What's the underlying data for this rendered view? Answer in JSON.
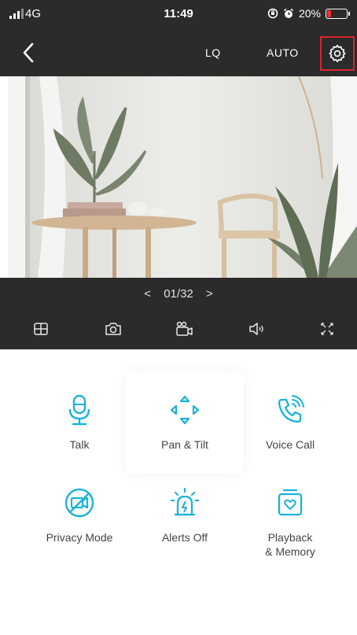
{
  "status_bar": {
    "network": "4G",
    "time": "11:49",
    "battery": "20%"
  },
  "nav": {
    "quality": "LQ",
    "mode": "AUTO"
  },
  "video": {
    "page": "01/32",
    "prev_symbol": "<",
    "next_symbol": ">"
  },
  "features": [
    {
      "label": "Talk",
      "icon": "microphone-icon"
    },
    {
      "label": "Pan & Tilt",
      "icon": "pan-tilt-icon"
    },
    {
      "label": "Voice Call",
      "icon": "phone-call-icon"
    },
    {
      "label": "Privacy Mode",
      "icon": "privacy-camera-off-icon"
    },
    {
      "label": "Alerts Off",
      "icon": "alarm-light-icon"
    },
    {
      "label": "Playback\n& Memory",
      "icon": "playback-memory-icon"
    }
  ],
  "colors": {
    "accent": "#1bb3d8",
    "highlight": "#d9262c",
    "bar": "#2b2b2b"
  }
}
